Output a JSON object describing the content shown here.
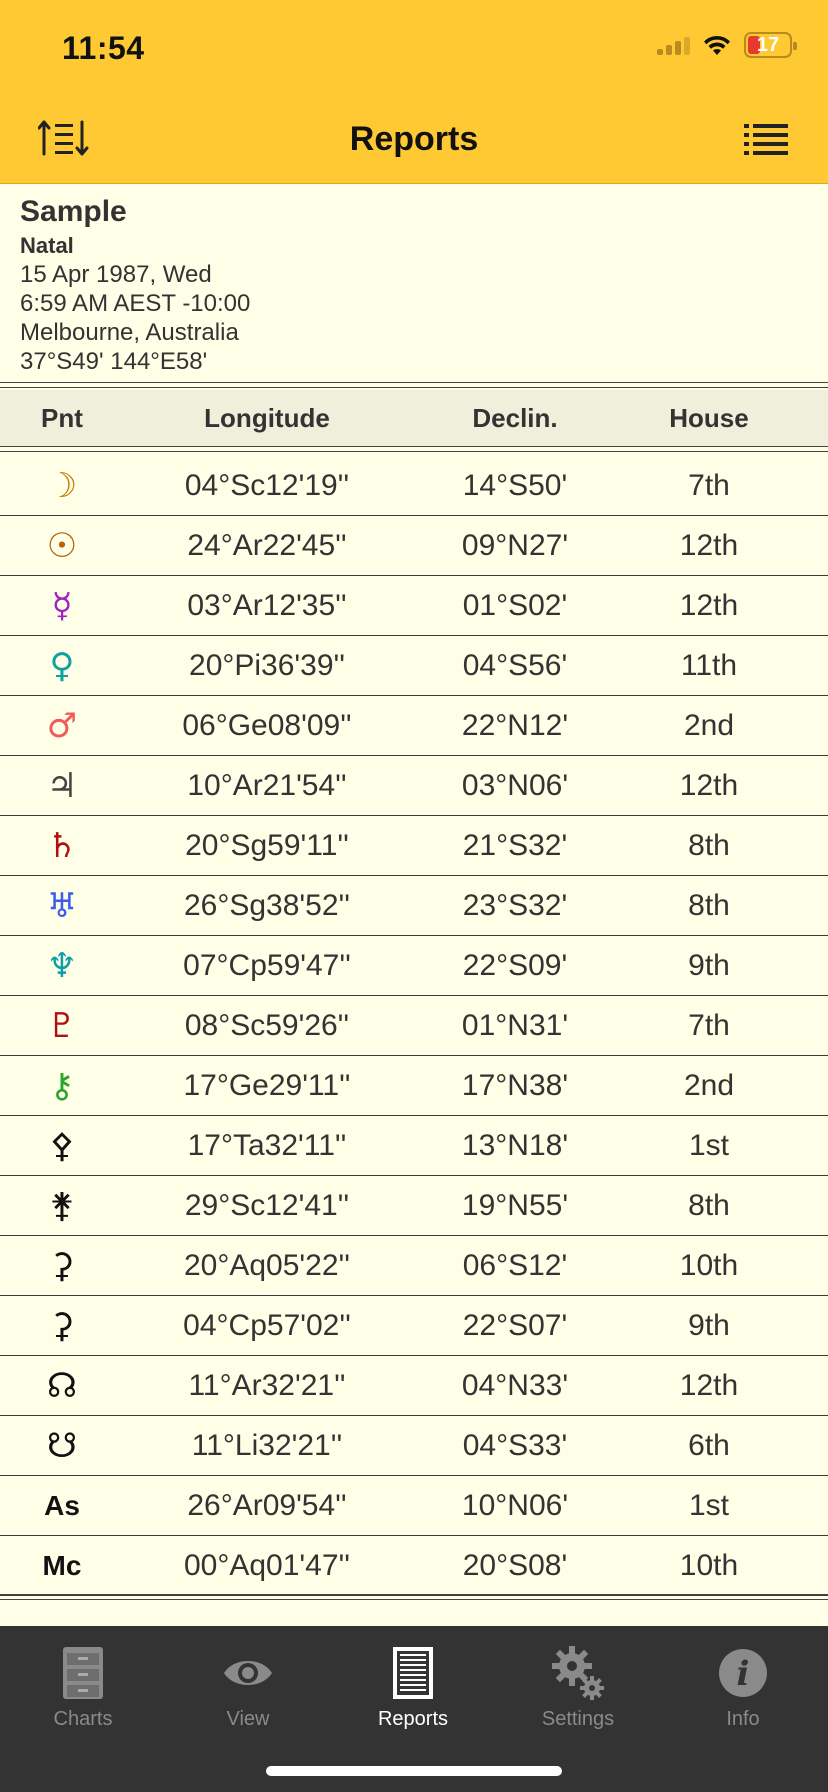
{
  "status": {
    "time": "11:54",
    "battery": "17"
  },
  "nav": {
    "title": "Reports"
  },
  "chart": {
    "name": "Sample",
    "type": "Natal",
    "date": "15 Apr 1987, Wed",
    "time": "6:59 AM AEST -10:00",
    "place": "Melbourne, Australia",
    "coords": "37°S49' 144°E58'"
  },
  "table": {
    "headers": {
      "pnt": "Pnt",
      "longitude": "Longitude",
      "declin": "Declin.",
      "house": "House"
    },
    "rows": [
      {
        "glyph": "☽",
        "color": "#c77800",
        "longitude": "04°Sc12'19''",
        "declin": "14°S50'",
        "house": "7th"
      },
      {
        "glyph": "☉",
        "color": "#b8620b",
        "longitude": "24°Ar22'45''",
        "declin": "09°N27'",
        "house": "12th"
      },
      {
        "glyph": "☿",
        "color": "#a020c8",
        "longitude": "03°Ar12'35''",
        "declin": "01°S02'",
        "house": "12th"
      },
      {
        "glyph": "♀",
        "color": "#0fa0a0",
        "longitude": "20°Pi36'39''",
        "declin": "04°S56'",
        "house": "11th"
      },
      {
        "glyph": "♂",
        "color": "#f05a5a",
        "longitude": "06°Ge08'09''",
        "declin": "22°N12'",
        "house": "2nd"
      },
      {
        "glyph": "♃",
        "color": "#444444",
        "longitude": "10°Ar21'54''",
        "declin": "03°N06'",
        "house": "12th"
      },
      {
        "glyph": "♄",
        "color": "#b01010",
        "longitude": "20°Sg59'11''",
        "declin": "21°S32'",
        "house": "8th"
      },
      {
        "glyph": "♅",
        "color": "#3a5cf0",
        "longitude": "26°Sg38'52''",
        "declin": "23°S32'",
        "house": "8th"
      },
      {
        "glyph": "♆",
        "color": "#0e9fa8",
        "longitude": "07°Cp59'47''",
        "declin": "22°S09'",
        "house": "9th"
      },
      {
        "glyph": "♇",
        "color": "#b01010",
        "longitude": "08°Sc59'26''",
        "declin": "01°N31'",
        "house": "7th"
      },
      {
        "glyph": "⚷",
        "color": "#2aa52a",
        "longitude": "17°Ge29'11''",
        "declin": "17°N38'",
        "house": "2nd"
      },
      {
        "glyph": "⚴",
        "color": "#111111",
        "longitude": "17°Ta32'11''",
        "declin": "13°N18'",
        "house": "1st"
      },
      {
        "glyph": "⚵",
        "color": "#111111",
        "longitude": "29°Sc12'41''",
        "declin": "19°N55'",
        "house": "8th"
      },
      {
        "glyph": "⚳",
        "color": "#111111",
        "longitude": "20°Aq05'22''",
        "declin": "06°S12'",
        "house": "10th"
      },
      {
        "glyph": "⚳",
        "color": "#111111",
        "longitude": "04°Cp57'02''",
        "declin": "22°S07'",
        "house": "9th"
      },
      {
        "glyph": "☊",
        "color": "#111111",
        "longitude": "11°Ar32'21''",
        "declin": "04°N33'",
        "house": "12th"
      },
      {
        "glyph": "☋",
        "color": "#111111",
        "longitude": "11°Li32'21''",
        "declin": "04°S33'",
        "house": "6th"
      },
      {
        "glyph": "As",
        "color": "#111111",
        "longitude": "26°Ar09'54''",
        "declin": "10°N06'",
        "house": "1st"
      },
      {
        "glyph": "Mc",
        "color": "#111111",
        "longitude": "00°Aq01'47''",
        "declin": "20°S08'",
        "house": "10th"
      }
    ]
  },
  "tabs": [
    {
      "label": "Charts",
      "icon": "file-cabinet-icon",
      "active": false
    },
    {
      "label": "View",
      "icon": "eye-icon",
      "active": false
    },
    {
      "label": "Reports",
      "icon": "report-icon",
      "active": true
    },
    {
      "label": "Settings",
      "icon": "gears-icon",
      "active": false
    },
    {
      "label": "Info",
      "icon": "info-icon",
      "active": false
    }
  ]
}
